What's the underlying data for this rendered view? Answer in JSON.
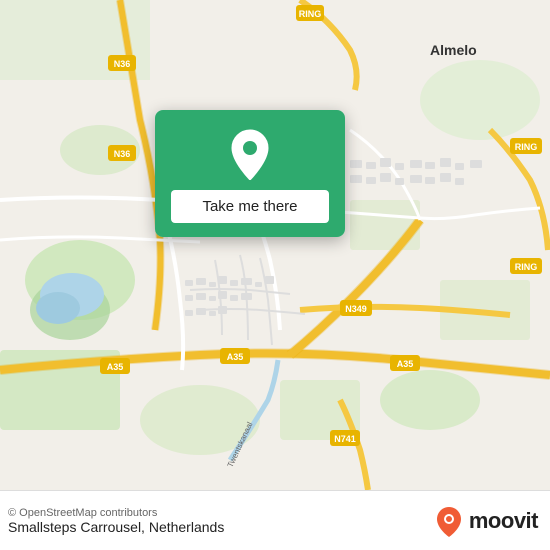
{
  "map": {
    "background_color": "#e8e0d8"
  },
  "popup": {
    "button_label": "Take me there",
    "pin_color": "#fff"
  },
  "footer": {
    "copyright": "© OpenStreetMap contributors",
    "location_name": "Smallsteps Carrousel, Netherlands",
    "moovit_label": "moovit"
  }
}
